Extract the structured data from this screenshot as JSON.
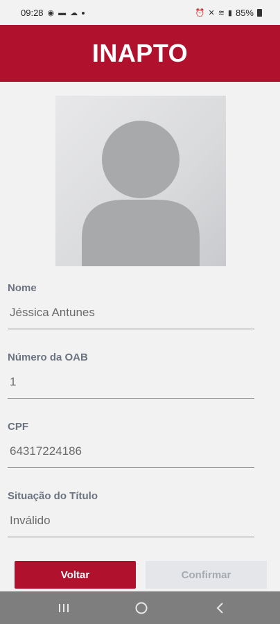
{
  "status_bar": {
    "time": "09:28",
    "battery": "85%"
  },
  "header": {
    "title": "INAPTO"
  },
  "photo": {
    "icon": "avatar-placeholder"
  },
  "fields": [
    {
      "label": "Nome",
      "value": "Jéssica Antunes"
    },
    {
      "label": "Número da OAB",
      "value": "1"
    },
    {
      "label": "CPF",
      "value": "64317224186"
    },
    {
      "label": "Situação do Título",
      "value": "Inválido"
    }
  ],
  "buttons": {
    "back": "Voltar",
    "confirm": "Confirmar"
  },
  "colors": {
    "brand": "#b0122d",
    "disabled_button": "#e4e6e9"
  }
}
